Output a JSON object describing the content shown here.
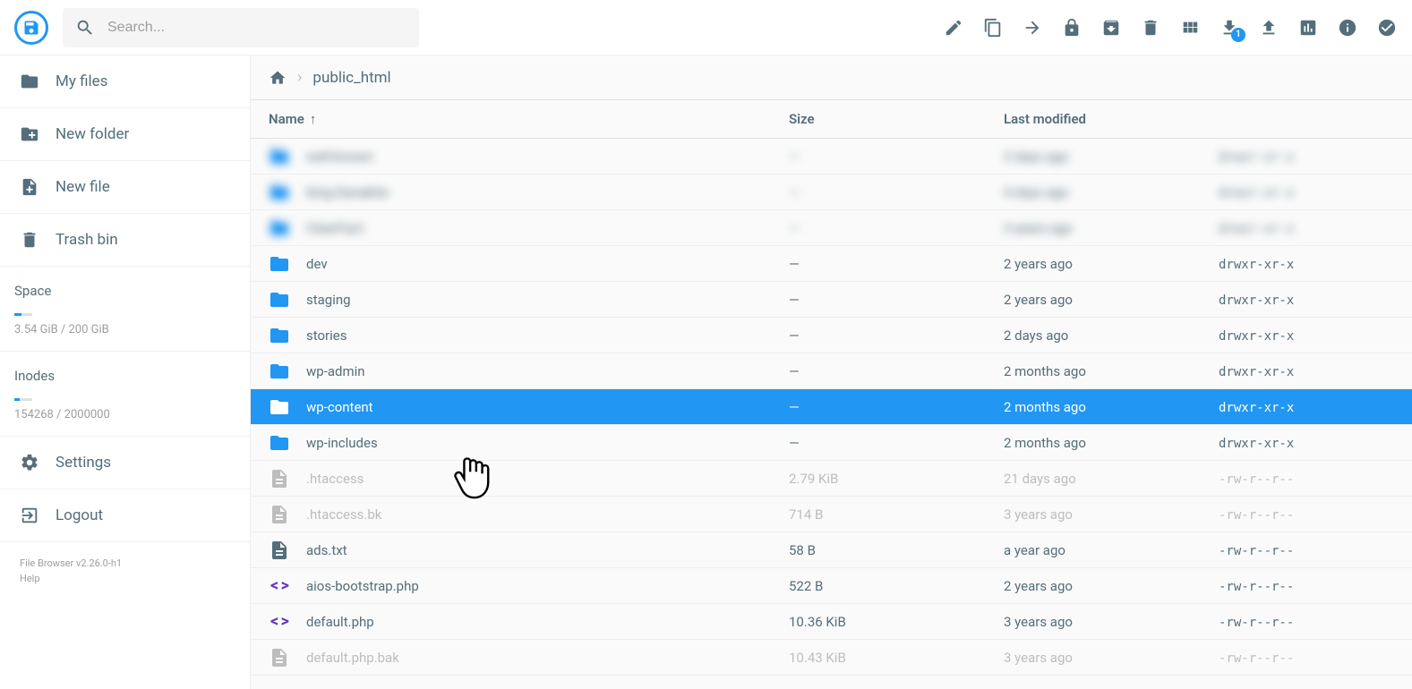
{
  "search": {
    "placeholder": "Search..."
  },
  "header_actions": {
    "download_badge": "1"
  },
  "sidebar": {
    "my_files": "My files",
    "new_folder": "New folder",
    "new_file": "New file",
    "trash": "Trash bin",
    "space_label": "Space",
    "space_usage": "3.54 GiB / 200 GiB",
    "inodes_label": "Inodes",
    "inodes_usage": "154268 / 2000000",
    "settings": "Settings",
    "logout": "Logout",
    "version": "File Browser v2.26.0-h1",
    "help": "Help"
  },
  "breadcrumb": {
    "current": "public_html"
  },
  "columns": {
    "name": "Name",
    "size": "Size",
    "modified": "Last modified"
  },
  "rows": [
    {
      "type": "folder",
      "name": "well-known",
      "size": "—",
      "modified": "2 days ago",
      "perm": "drwxr-xr-x",
      "blurred": true
    },
    {
      "type": "folder",
      "name": "blog-Danakite",
      "size": "—",
      "modified": "4 days ago",
      "perm": "drwxr-xr-x",
      "blurred": true
    },
    {
      "type": "folder",
      "name": "ClearFact",
      "size": "—",
      "modified": "3 years ago",
      "perm": "drwxr-xr-x",
      "blurred": true
    },
    {
      "type": "folder",
      "name": "dev",
      "size": "—",
      "modified": "2 years ago",
      "perm": "drwxr-xr-x"
    },
    {
      "type": "folder",
      "name": "staging",
      "size": "—",
      "modified": "2 years ago",
      "perm": "drwxr-xr-x"
    },
    {
      "type": "folder",
      "name": "stories",
      "size": "—",
      "modified": "2 days ago",
      "perm": "drwxr-xr-x"
    },
    {
      "type": "folder",
      "name": "wp-admin",
      "size": "—",
      "modified": "2 months ago",
      "perm": "drwxr-xr-x"
    },
    {
      "type": "folder",
      "name": "wp-content",
      "size": "—",
      "modified": "2 months ago",
      "perm": "drwxr-xr-x",
      "selected": true
    },
    {
      "type": "folder",
      "name": "wp-includes",
      "size": "—",
      "modified": "2 months ago",
      "perm": "drwxr-xr-x"
    },
    {
      "type": "file",
      "name": ".htaccess",
      "size": "2.79 KiB",
      "modified": "21 days ago",
      "perm": "-rw-r--r--",
      "muted": true
    },
    {
      "type": "file",
      "name": ".htaccess.bk",
      "size": "714 B",
      "modified": "3 years ago",
      "perm": "-rw-r--r--",
      "muted": true
    },
    {
      "type": "file",
      "name": "ads.txt",
      "size": "58 B",
      "modified": "a year ago",
      "perm": "-rw-r--r--"
    },
    {
      "type": "code",
      "name": "aios-bootstrap.php",
      "size": "522 B",
      "modified": "2 years ago",
      "perm": "-rw-r--r--"
    },
    {
      "type": "code",
      "name": "default.php",
      "size": "10.36 KiB",
      "modified": "3 years ago",
      "perm": "-rw-r--r--"
    },
    {
      "type": "file",
      "name": "default.php.bak",
      "size": "10.43 KiB",
      "modified": "3 years ago",
      "perm": "-rw-r--r--",
      "muted": true
    }
  ]
}
